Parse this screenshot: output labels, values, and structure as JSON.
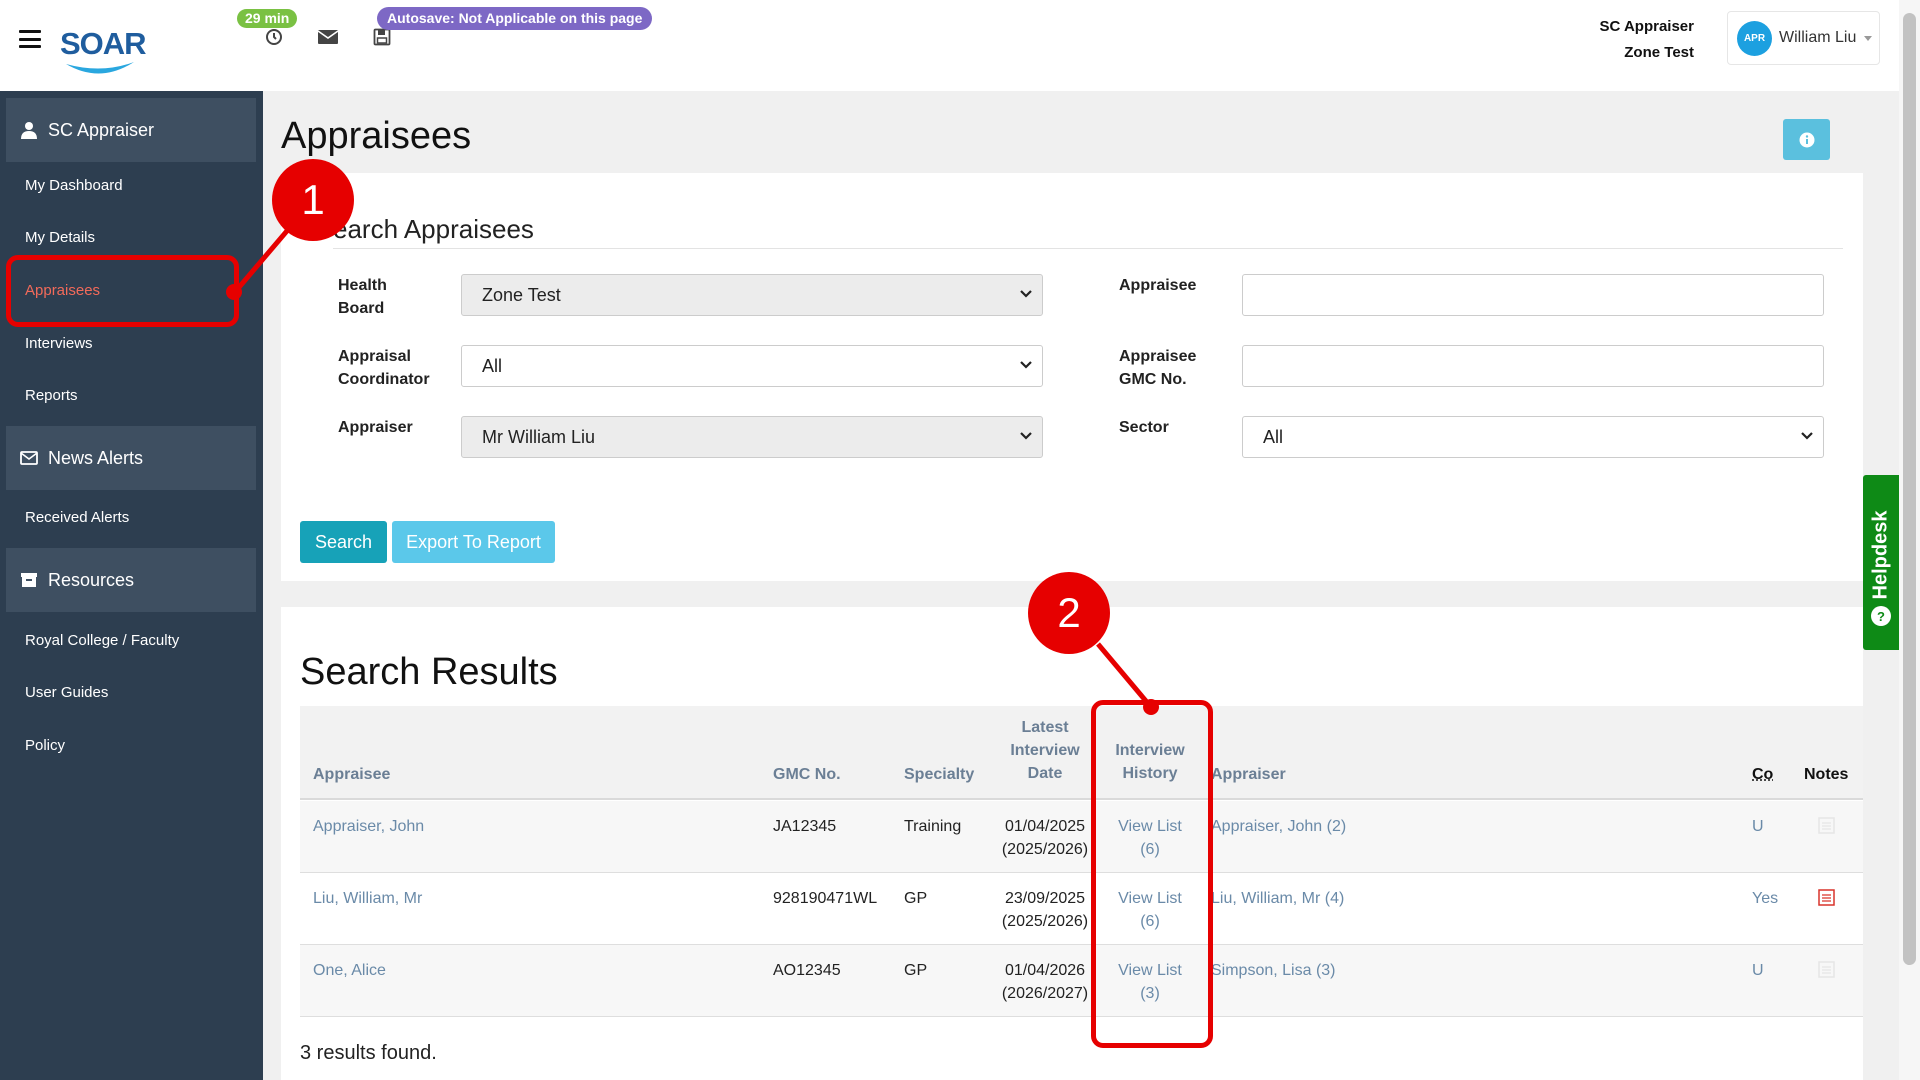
{
  "header": {
    "logo_text": "SOAR",
    "timer_badge": "29 min",
    "autosave_badge": "Autosave: Not Applicable on this page",
    "role_line1": "SC Appraiser",
    "role_line2": "Zone Test",
    "avatar_initials": "APR",
    "user_name": "William Liu",
    "icons": [
      "menu-icon",
      "clock-icon",
      "mail-icon",
      "save-icon",
      "chevron-down-icon"
    ]
  },
  "sidebar": {
    "section_user": "SC Appraiser",
    "items_user": [
      "My Dashboard",
      "My Details",
      "Appraisees",
      "Interviews",
      "Reports"
    ],
    "active_item": "Appraisees",
    "section_news": "News Alerts",
    "items_news": [
      "Received Alerts"
    ],
    "section_resources": "Resources",
    "items_resources": [
      "Royal College / Faculty",
      "User Guides",
      "Policy"
    ]
  },
  "page": {
    "title": "Appraisees"
  },
  "search": {
    "heading": "earch Appraisees",
    "health_board_label_1": "Health",
    "health_board_label_2": "Board",
    "health_board_value": "Zone Test",
    "coordinator_label_1": "Appraisal",
    "coordinator_label_2": "Coordinator",
    "coordinator_value": "All",
    "appraiser_label": "Appraiser",
    "appraiser_value": "Mr William Liu",
    "appraisee_label": "Appraisee",
    "appraisee_value": "",
    "gmc_label_1": "Appraisee",
    "gmc_label_2": "GMC No.",
    "gmc_value": "",
    "sector_label": "Sector",
    "sector_value": "All",
    "search_button": "Search",
    "export_button": "Export To Report"
  },
  "results": {
    "title": "Search Results",
    "headers": {
      "appraisee": "Appraisee",
      "gmc": "GMC No.",
      "specialty": "Specialty",
      "latest_1": "Latest",
      "latest_2": "Interview",
      "latest_3": "Date",
      "history_1": "Interview",
      "history_2": "History",
      "appraiser": "Appraiser",
      "co": "Co",
      "notes": "Notes"
    },
    "rows": [
      {
        "appraisee": "Appraiser, John",
        "gmc": "JA12345",
        "specialty": "Training",
        "date": "01/04/2025",
        "period": "(2025/2026)",
        "history_1": "View List",
        "history_2": "(6)",
        "appraiser": "Appraiser, John (2)",
        "co": "U",
        "note_state": "empty"
      },
      {
        "appraisee": "Liu, William, Mr",
        "gmc": "928190471WL",
        "specialty": "GP",
        "date": "23/09/2025",
        "period": "(2025/2026)",
        "history_1": "View List",
        "history_2": "(6)",
        "appraiser": "Liu, William, Mr (4)",
        "co": "Yes",
        "note_state": "has-note"
      },
      {
        "appraisee": "One, Alice",
        "gmc": "AO12345",
        "specialty": "GP",
        "date": "01/04/2026",
        "period": "(2026/2027)",
        "history_1": "View List",
        "history_2": "(3)",
        "appraiser": "Simpson, Lisa (3)",
        "co": "U",
        "note_state": "empty"
      }
    ],
    "count_text": "3 results found."
  },
  "helpdesk": {
    "label": "Helpdesk",
    "icon_glyph": "?"
  },
  "annotations": {
    "step1": "1",
    "step2": "2"
  },
  "colors": {
    "sidebar_bg": "#2d3e50",
    "active_link": "#f26a5a",
    "accent_teal": "#17a2b8",
    "accent_light": "#5bc8ea",
    "timer_green": "#7ac143",
    "autosave_purple": "#7d68c5",
    "helpdesk_green": "#0e8a16",
    "annotation_red": "#e60000"
  }
}
